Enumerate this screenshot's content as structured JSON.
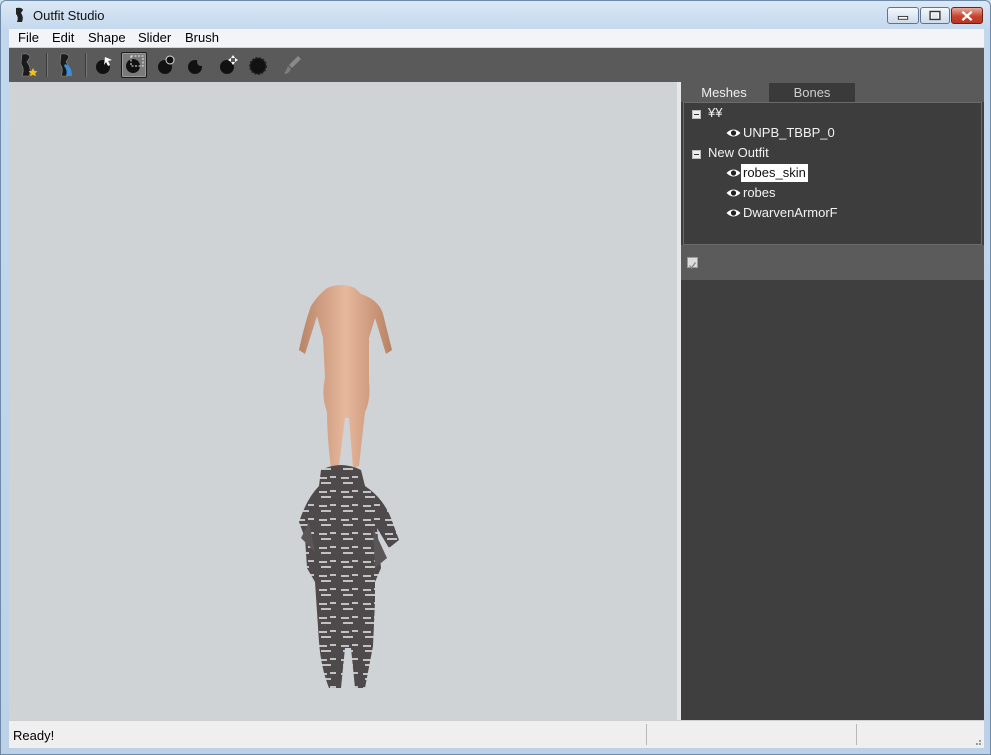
{
  "window": {
    "title": "Outfit Studio"
  },
  "menu": {
    "items": [
      "File",
      "Edit",
      "Shape",
      "Slider",
      "Brush"
    ]
  },
  "toolbar": {
    "tools": [
      "load-reference-icon",
      "load-outfit-icon",
      "select-brush-icon",
      "mask-brush-icon",
      "inflate-brush-icon",
      "deflate-brush-icon",
      "move-brush-icon",
      "smooth-brush-icon",
      "weight-paint-icon"
    ],
    "selected": "mask-brush-icon"
  },
  "panel": {
    "tabs": {
      "meshes": "Meshes",
      "bones": "Bones"
    },
    "active_tab": "Meshes",
    "tree": {
      "group1": {
        "label": "¥¥",
        "items": [
          "UNPB_TBBP_0"
        ]
      },
      "group2": {
        "label": "New Outfit",
        "items": [
          "robes_skin",
          "robes",
          "DwarvenArmorF"
        ]
      },
      "selected": "robes_skin"
    },
    "option_checked": true
  },
  "status": {
    "text": "Ready!"
  },
  "colors": {
    "viewport_bg": "#d0d3d5",
    "panel_bg": "#3f3f3f",
    "toolbar_bg": "#5a5a5a",
    "selection_bg": "#ffffff"
  }
}
